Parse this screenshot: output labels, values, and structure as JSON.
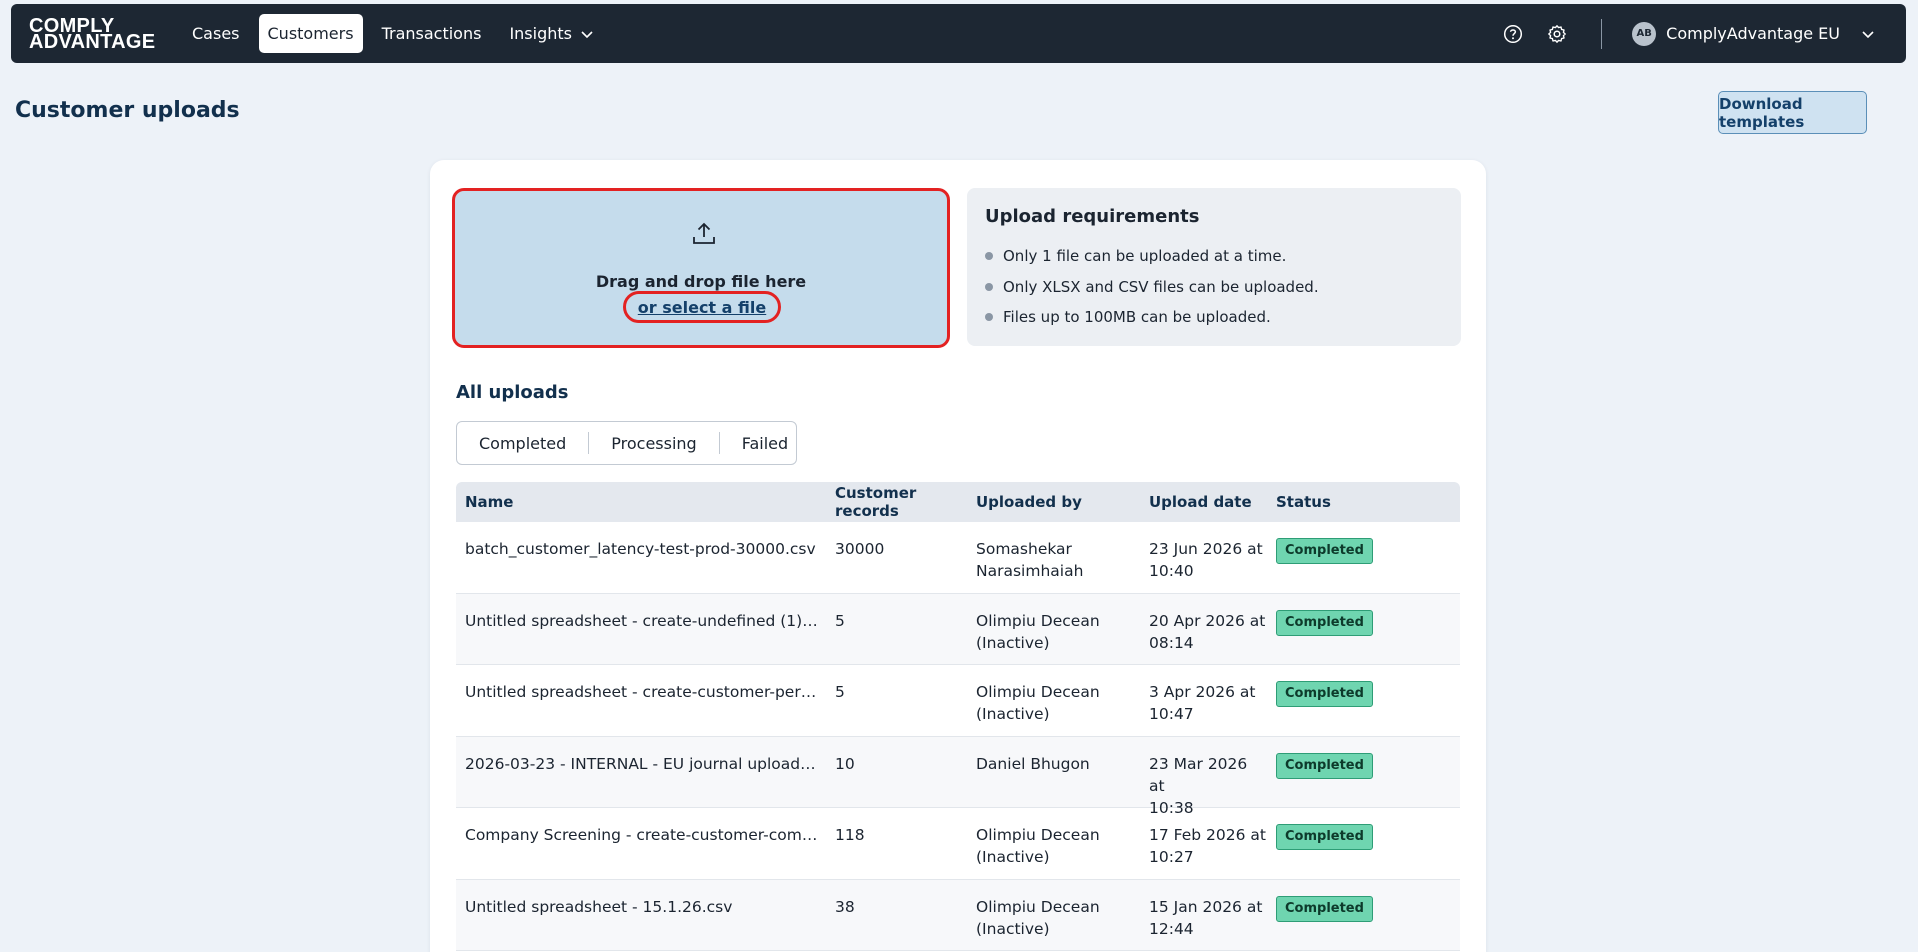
{
  "nav": {
    "logo_line1": "COMPLY",
    "logo_line2": "ADVANTAGE",
    "items": [
      {
        "label": "Cases"
      },
      {
        "label": "Customers",
        "active": true
      },
      {
        "label": "Transactions"
      },
      {
        "label": "Insights"
      }
    ],
    "account_initials": "AB",
    "account_name": "ComplyAdvantage EU"
  },
  "page": {
    "title": "Customer uploads",
    "download_label": "Download templates"
  },
  "dropzone": {
    "text": "Drag and drop file here",
    "link": "or select a file"
  },
  "requirements": {
    "title": "Upload requirements",
    "items": [
      "Only 1 file can be uploaded at a time.",
      "Only XLSX and CSV files can be uploaded.",
      "Files up to 100MB can be uploaded."
    ]
  },
  "uploads": {
    "title": "All uploads",
    "tabs": [
      "Completed",
      "Processing",
      "Failed"
    ],
    "columns": [
      "Name",
      "Customer records",
      "Uploaded by",
      "Upload date",
      "Status"
    ],
    "rows": [
      {
        "name": "batch_customer_latency-test-prod-30000.csv",
        "records": "30000",
        "by_1": "Somashekar",
        "by_2": "Narasimhaiah",
        "date_1": "23 Jun 2026 at",
        "date_2": "10:40",
        "status": "Completed"
      },
      {
        "name": "Untitled spreadsheet - create-undefined (1) - cr...",
        "records": "5",
        "by_1": "Olimpiu Decean",
        "by_2": "(Inactive)",
        "date_1": "20 Apr 2026 at",
        "date_2": "08:14",
        "status": "Completed"
      },
      {
        "name": "Untitled spreadsheet - create-customer-person...",
        "records": "5",
        "by_1": "Olimpiu Decean",
        "by_2": "(Inactive)",
        "date_1": "3 Apr 2026 at",
        "date_2": "10:47",
        "status": "Completed"
      },
      {
        "name": "2026-03-23 - INTERNAL - EU journal upload - Sh...",
        "records": "10",
        "by_1": "Daniel Bhugon",
        "by_2": "",
        "date_1": "23 Mar 2026 at",
        "date_2": "10:38",
        "status": "Completed"
      },
      {
        "name": "Company Screening - create-customer-compan...",
        "records": "118",
        "by_1": "Olimpiu Decean",
        "by_2": "(Inactive)",
        "date_1": "17 Feb 2026 at",
        "date_2": "10:27",
        "status": "Completed"
      },
      {
        "name": "Untitled spreadsheet - 15.1.26.csv",
        "records": "38",
        "by_1": "Olimpiu Decean",
        "by_2": "(Inactive)",
        "date_1": "15 Jan 2026 at",
        "date_2": "12:44",
        "status": "Completed"
      }
    ]
  }
}
